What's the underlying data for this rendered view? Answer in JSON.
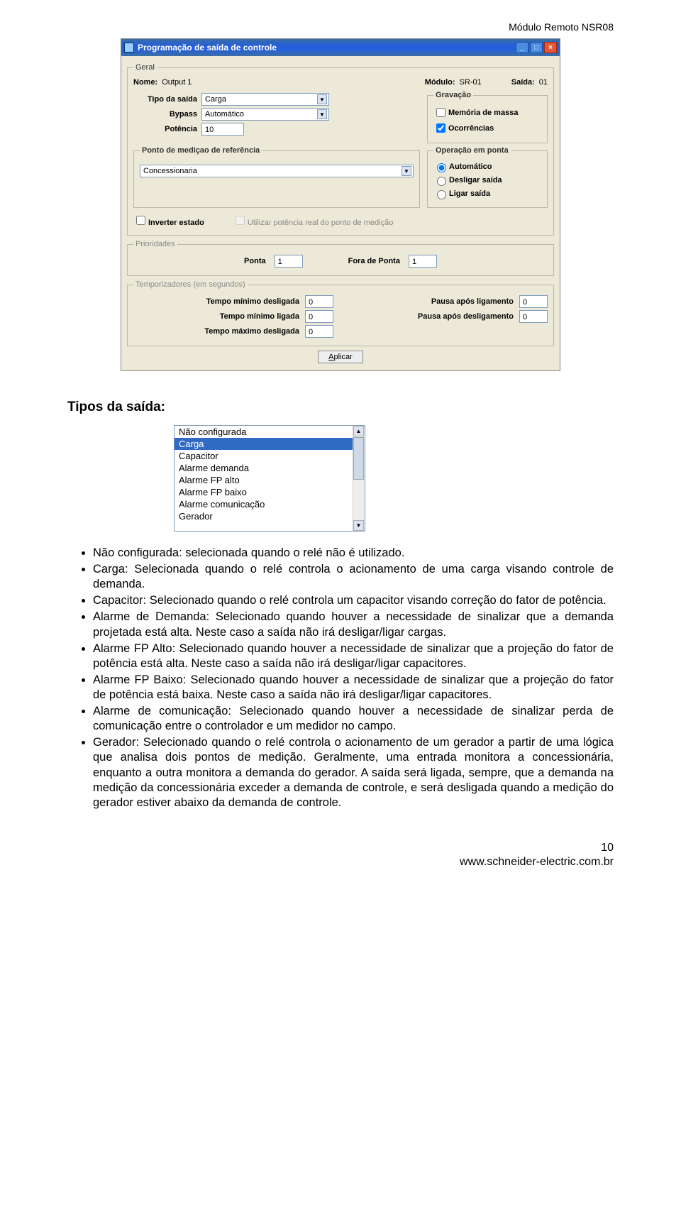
{
  "header_right": "Módulo Remoto NSR08",
  "win": {
    "title": "Programação de saída de controle",
    "geral": {
      "legend": "Geral",
      "nome_label": "Nome:",
      "nome_value": "Output 1",
      "modulo_label": "Módulo:",
      "modulo_value": "SR-01",
      "saida_label": "Saída:",
      "saida_value": "01",
      "tipo_label": "Tipo da saída",
      "tipo_value": "Carga",
      "bypass_label": "Bypass",
      "bypass_value": "Automático",
      "potencia_label": "Potência",
      "potencia_value": "10",
      "gravacao_legend": "Gravação",
      "gravacao_massa": "Memória de massa",
      "gravacao_ocorr": "Ocorrências",
      "ponto_legend": "Ponto de mediçao de referência",
      "ponto_value": "Concessionaria",
      "operacao_legend": "Operação em ponta",
      "op_auto": "Automático",
      "op_deslig": "Desligar saída",
      "op_ligar": "Ligar saída",
      "inverter_label": "Inverter estado",
      "utilizar_label": "Utilizar potência real do ponto de medição"
    },
    "prioridades": {
      "legend": "Prioridades",
      "ponta_label": "Ponta",
      "ponta_value": "1",
      "fora_label": "Fora de Ponta",
      "fora_value": "1"
    },
    "temporizadores": {
      "legend": "Temporizadores (em segundos)",
      "tmin_desl_label": "Tempo mínimo desligada",
      "tmin_desl_value": "0",
      "tmin_lig_label": "Tempo mínimo ligada",
      "tmin_lig_value": "0",
      "tmax_desl_label": "Tempo máximo desligada",
      "tmax_desl_value": "0",
      "pausa_lig_label": "Pausa após ligamento",
      "pausa_lig_value": "0",
      "pausa_desl_label": "Pausa após desligamento",
      "pausa_desl_value": "0"
    },
    "aplicar_btn": "Aplicar"
  },
  "section_title": "Tipos da saída:",
  "listbox": {
    "items": [
      "Não configurada",
      "Carga",
      "Capacitor",
      "Alarme demanda",
      "Alarme FP alto",
      "Alarme FP baixo",
      "Alarme comunicação",
      "Gerador"
    ],
    "selected_index": 1
  },
  "bullets": [
    "Não configurada: selecionada quando o relé não é utilizado.",
    "Carga: Selecionada quando o relé controla o acionamento de uma carga visando controle de demanda.",
    "Capacitor: Selecionado quando o relé controla um capacitor visando correção do fator de potência.",
    "Alarme de Demanda: Selecionado quando houver a necessidade de sinalizar que a demanda projetada está alta. Neste caso a saída não irá desligar/ligar cargas.",
    "Alarme FP Alto: Selecionado quando houver a necessidade de sinalizar que a projeção do fator de potência está alta. Neste caso a saída não irá desligar/ligar capacitores.",
    "Alarme FP Baixo: Selecionado quando houver a necessidade de sinalizar que a projeção do fator de potência está baixa. Neste caso a saída não irá desligar/ligar capacitores.",
    "Alarme de comunicação: Selecionado quando houver a necessidade de sinalizar perda de comunicação entre o controlador e um medidor no campo.",
    "Gerador: Selecionado quando o relé controla o acionamento de um gerador a partir de uma lógica que analisa dois pontos de medição. Geralmente, uma entrada monitora a concessionária, enquanto a outra monitora a demanda do gerador. A saída será ligada, sempre, que a demanda na medição da concessionária exceder a demanda de controle, e será desligada quando a medição do gerador estiver abaixo da demanda de controle."
  ],
  "footer": {
    "page": "10",
    "url": "www.schneider-electric.com.br"
  }
}
